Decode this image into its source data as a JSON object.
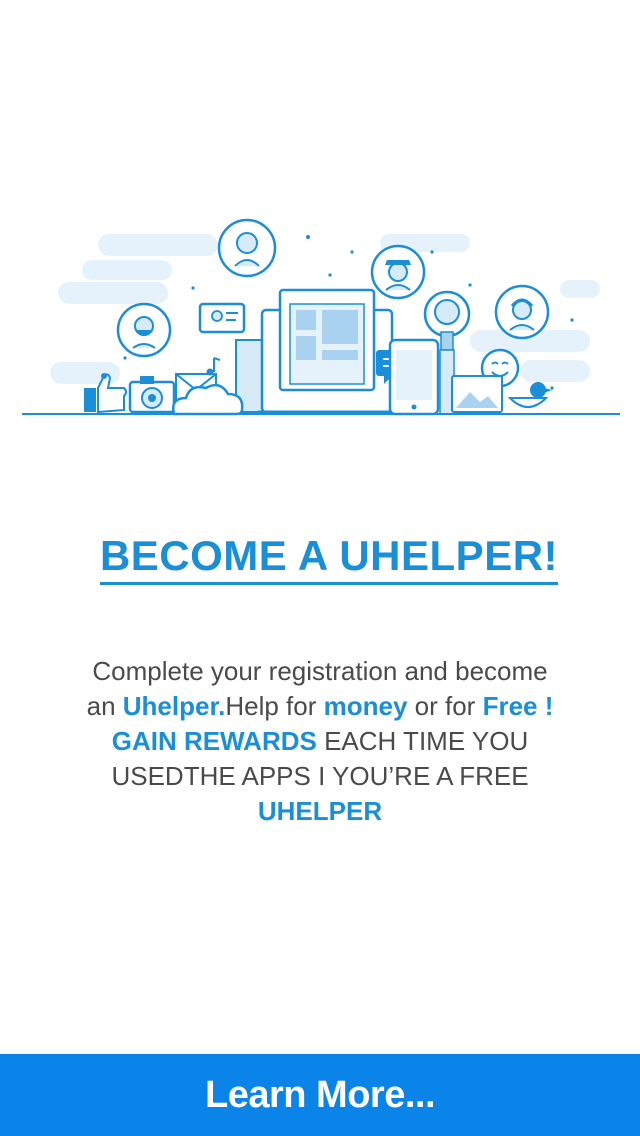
{
  "headline": "BECOME A UHELPER!",
  "description": {
    "line1": "Complete your registration and become",
    "line2_a": "an ",
    "line2_brand": "Uhelper.",
    "line2_b": "Help for ",
    "line2_money": "money",
    "line2_c": " or for ",
    "line2_free": "Free !",
    "line3_rewards": "GAIN REWARDS",
    "line3_rest": " EACH TIME YOU",
    "line4": "USEDTHE APPS I YOU’RE A FREE",
    "line5": "UHELPER"
  },
  "cta": {
    "label": "Learn More..."
  },
  "colors": {
    "accent": "#1a8fd8",
    "button": "#0a84e8",
    "text": "#4a4a4a",
    "illustration_light": "#e6f2fb"
  },
  "illustration_icons": [
    "woman-avatar-icon",
    "man-avatar-icon",
    "bearded-man-avatar-icon",
    "girl-avatar-icon",
    "photo-card-icon",
    "laptop-icon",
    "phone-icon",
    "lightbulb-icon",
    "chat-bubble-icon",
    "smiley-icon",
    "bird-icon",
    "camera-icon",
    "cloud-icon",
    "thumbs-up-icon",
    "music-note-icon",
    "envelope-icon"
  ]
}
